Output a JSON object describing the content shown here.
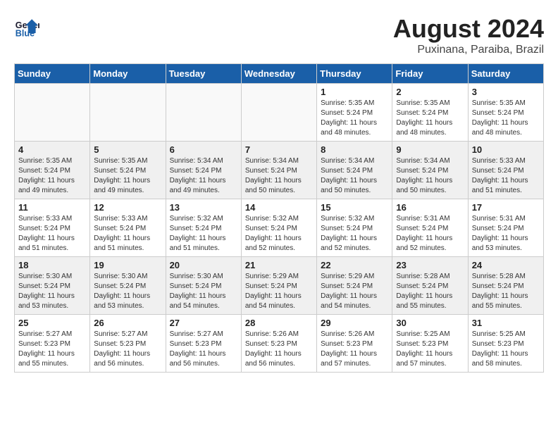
{
  "header": {
    "logo_line1": "General",
    "logo_line2": "Blue",
    "month_year": "August 2024",
    "location": "Puxinana, Paraiba, Brazil"
  },
  "days_of_week": [
    "Sunday",
    "Monday",
    "Tuesday",
    "Wednesday",
    "Thursday",
    "Friday",
    "Saturday"
  ],
  "weeks": [
    [
      {
        "day": "",
        "info": ""
      },
      {
        "day": "",
        "info": ""
      },
      {
        "day": "",
        "info": ""
      },
      {
        "day": "",
        "info": ""
      },
      {
        "day": "1",
        "info": "Sunrise: 5:35 AM\nSunset: 5:24 PM\nDaylight: 11 hours\nand 48 minutes."
      },
      {
        "day": "2",
        "info": "Sunrise: 5:35 AM\nSunset: 5:24 PM\nDaylight: 11 hours\nand 48 minutes."
      },
      {
        "day": "3",
        "info": "Sunrise: 5:35 AM\nSunset: 5:24 PM\nDaylight: 11 hours\nand 48 minutes."
      }
    ],
    [
      {
        "day": "4",
        "info": "Sunrise: 5:35 AM\nSunset: 5:24 PM\nDaylight: 11 hours\nand 49 minutes."
      },
      {
        "day": "5",
        "info": "Sunrise: 5:35 AM\nSunset: 5:24 PM\nDaylight: 11 hours\nand 49 minutes."
      },
      {
        "day": "6",
        "info": "Sunrise: 5:34 AM\nSunset: 5:24 PM\nDaylight: 11 hours\nand 49 minutes."
      },
      {
        "day": "7",
        "info": "Sunrise: 5:34 AM\nSunset: 5:24 PM\nDaylight: 11 hours\nand 50 minutes."
      },
      {
        "day": "8",
        "info": "Sunrise: 5:34 AM\nSunset: 5:24 PM\nDaylight: 11 hours\nand 50 minutes."
      },
      {
        "day": "9",
        "info": "Sunrise: 5:34 AM\nSunset: 5:24 PM\nDaylight: 11 hours\nand 50 minutes."
      },
      {
        "day": "10",
        "info": "Sunrise: 5:33 AM\nSunset: 5:24 PM\nDaylight: 11 hours\nand 51 minutes."
      }
    ],
    [
      {
        "day": "11",
        "info": "Sunrise: 5:33 AM\nSunset: 5:24 PM\nDaylight: 11 hours\nand 51 minutes."
      },
      {
        "day": "12",
        "info": "Sunrise: 5:33 AM\nSunset: 5:24 PM\nDaylight: 11 hours\nand 51 minutes."
      },
      {
        "day": "13",
        "info": "Sunrise: 5:32 AM\nSunset: 5:24 PM\nDaylight: 11 hours\nand 51 minutes."
      },
      {
        "day": "14",
        "info": "Sunrise: 5:32 AM\nSunset: 5:24 PM\nDaylight: 11 hours\nand 52 minutes."
      },
      {
        "day": "15",
        "info": "Sunrise: 5:32 AM\nSunset: 5:24 PM\nDaylight: 11 hours\nand 52 minutes."
      },
      {
        "day": "16",
        "info": "Sunrise: 5:31 AM\nSunset: 5:24 PM\nDaylight: 11 hours\nand 52 minutes."
      },
      {
        "day": "17",
        "info": "Sunrise: 5:31 AM\nSunset: 5:24 PM\nDaylight: 11 hours\nand 53 minutes."
      }
    ],
    [
      {
        "day": "18",
        "info": "Sunrise: 5:30 AM\nSunset: 5:24 PM\nDaylight: 11 hours\nand 53 minutes."
      },
      {
        "day": "19",
        "info": "Sunrise: 5:30 AM\nSunset: 5:24 PM\nDaylight: 11 hours\nand 53 minutes."
      },
      {
        "day": "20",
        "info": "Sunrise: 5:30 AM\nSunset: 5:24 PM\nDaylight: 11 hours\nand 54 minutes."
      },
      {
        "day": "21",
        "info": "Sunrise: 5:29 AM\nSunset: 5:24 PM\nDaylight: 11 hours\nand 54 minutes."
      },
      {
        "day": "22",
        "info": "Sunrise: 5:29 AM\nSunset: 5:24 PM\nDaylight: 11 hours\nand 54 minutes."
      },
      {
        "day": "23",
        "info": "Sunrise: 5:28 AM\nSunset: 5:24 PM\nDaylight: 11 hours\nand 55 minutes."
      },
      {
        "day": "24",
        "info": "Sunrise: 5:28 AM\nSunset: 5:24 PM\nDaylight: 11 hours\nand 55 minutes."
      }
    ],
    [
      {
        "day": "25",
        "info": "Sunrise: 5:27 AM\nSunset: 5:23 PM\nDaylight: 11 hours\nand 55 minutes."
      },
      {
        "day": "26",
        "info": "Sunrise: 5:27 AM\nSunset: 5:23 PM\nDaylight: 11 hours\nand 56 minutes."
      },
      {
        "day": "27",
        "info": "Sunrise: 5:27 AM\nSunset: 5:23 PM\nDaylight: 11 hours\nand 56 minutes."
      },
      {
        "day": "28",
        "info": "Sunrise: 5:26 AM\nSunset: 5:23 PM\nDaylight: 11 hours\nand 56 minutes."
      },
      {
        "day": "29",
        "info": "Sunrise: 5:26 AM\nSunset: 5:23 PM\nDaylight: 11 hours\nand 57 minutes."
      },
      {
        "day": "30",
        "info": "Sunrise: 5:25 AM\nSunset: 5:23 PM\nDaylight: 11 hours\nand 57 minutes."
      },
      {
        "day": "31",
        "info": "Sunrise: 5:25 AM\nSunset: 5:23 PM\nDaylight: 11 hours\nand 58 minutes."
      }
    ]
  ]
}
